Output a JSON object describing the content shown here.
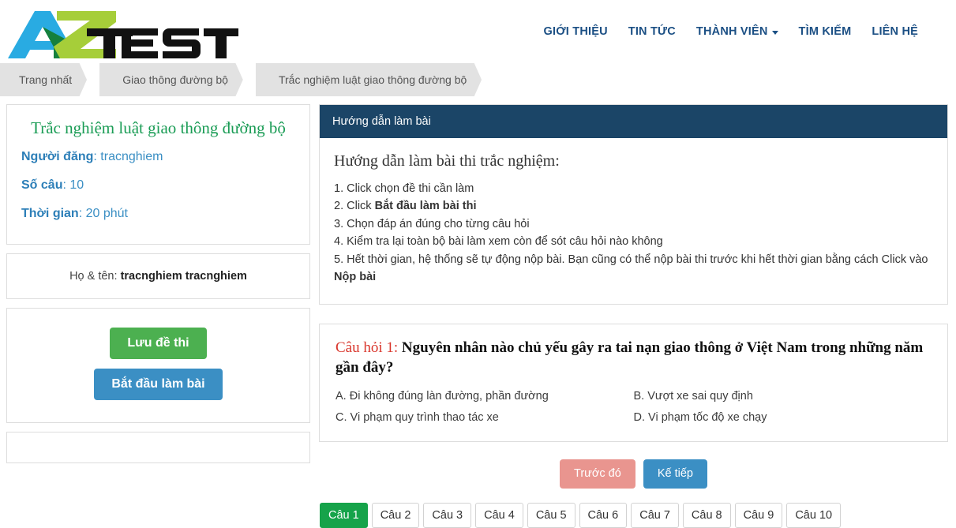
{
  "header": {
    "logo_text": "AZTEST",
    "nav": [
      {
        "label": "GIỚI THIỆU",
        "has_caret": false
      },
      {
        "label": "TIN TỨC",
        "has_caret": false
      },
      {
        "label": "THÀNH VIÊN",
        "has_caret": true
      },
      {
        "label": "TÌM KIẾM",
        "has_caret": false
      },
      {
        "label": "LIÊN HỆ",
        "has_caret": false
      }
    ]
  },
  "breadcrumb": [
    "Trang nhất",
    "Giao thông đường bộ",
    "Trắc nghiệm luật giao thông đường bộ"
  ],
  "sidebar": {
    "quiz_title": "Trắc nghiệm luật giao thông đường bộ",
    "meta": [
      {
        "label": "Người đăng",
        "value": "tracnghiem"
      },
      {
        "label": "Số câu",
        "value": "10"
      },
      {
        "label": "Thời gian",
        "value": "20 phút"
      }
    ],
    "name_label": "Họ & tên:",
    "name_value": "tracnghiem tracnghiem",
    "save_button": "Lưu đề thi",
    "start_button": "Bắt đầu làm bài"
  },
  "guide": {
    "panel_title": "Hướng dẫn làm bài",
    "heading": "Hướng dẫn làm bài thi trắc nghiệm:",
    "steps": [
      {
        "pre": "Click chọn đề thi cần làm",
        "bold": "",
        "post": ""
      },
      {
        "pre": "Click ",
        "bold": "Bắt đầu làm bài thi",
        "post": ""
      },
      {
        "pre": "Chọn đáp án đúng cho từng câu hỏi",
        "bold": "",
        "post": ""
      },
      {
        "pre": "Kiểm tra lại toàn bộ bài làm xem còn để sót câu hỏi nào không",
        "bold": "",
        "post": ""
      },
      {
        "pre": "Hết thời gian, hệ thống sẽ tự động nộp bài. Bạn cũng có thể nộp bài thi trước khi hết thời gian bằng cách Click vào ",
        "bold": "Nộp bài",
        "post": ""
      }
    ]
  },
  "question": {
    "label": "Câu hỏi 1:",
    "text": "Nguyên nhân nào chủ yếu gây ra tai nạn giao thông ở Việt Nam trong những năm gần đây?",
    "answers": [
      "A. Đi không đúng làn đường, phần đường",
      "B. Vượt xe sai quy định",
      "C. Vi phạm quy trình thao tác xe",
      "D. Vi phạm tốc độ xe chạy"
    ],
    "prev_button": "Trước đó",
    "next_button": "Kế tiếp"
  },
  "question_tabs": {
    "active_index": 0,
    "items": [
      "Câu 1",
      "Câu 2",
      "Câu 3",
      "Câu 4",
      "Câu 5",
      "Câu 6",
      "Câu 7",
      "Câu 8",
      "Câu 9",
      "Câu 10"
    ]
  },
  "colors": {
    "nav_blue": "#1b4f84",
    "panel_header_navy": "#1b4567",
    "title_green": "#1a9c55",
    "meta_blue": "#3b8fc4",
    "save_green": "#4cb050",
    "start_blue": "#3b8fc4",
    "prev_salmon": "#e9958f",
    "question_red": "#d9362c",
    "active_tab_green": "#16a34a",
    "logo_blue": "#29abe2",
    "logo_green": "#a6ce39",
    "logo_dark_green": "#15803d"
  }
}
